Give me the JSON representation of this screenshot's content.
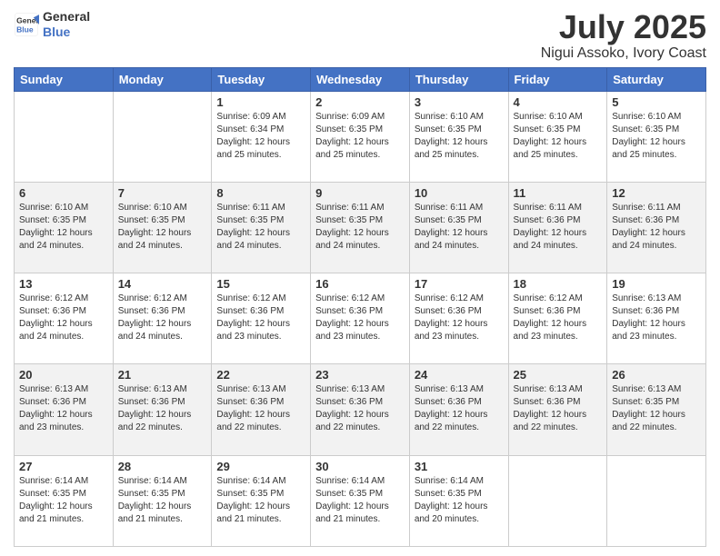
{
  "header": {
    "logo_line1": "General",
    "logo_line2": "Blue",
    "title": "July 2025",
    "subtitle": "Nigui Assoko, Ivory Coast"
  },
  "days_of_week": [
    "Sunday",
    "Monday",
    "Tuesday",
    "Wednesday",
    "Thursday",
    "Friday",
    "Saturday"
  ],
  "weeks": [
    [
      {
        "day": "",
        "info": ""
      },
      {
        "day": "",
        "info": ""
      },
      {
        "day": "1",
        "info": "Sunrise: 6:09 AM\nSunset: 6:34 PM\nDaylight: 12 hours\nand 25 minutes."
      },
      {
        "day": "2",
        "info": "Sunrise: 6:09 AM\nSunset: 6:35 PM\nDaylight: 12 hours\nand 25 minutes."
      },
      {
        "day": "3",
        "info": "Sunrise: 6:10 AM\nSunset: 6:35 PM\nDaylight: 12 hours\nand 25 minutes."
      },
      {
        "day": "4",
        "info": "Sunrise: 6:10 AM\nSunset: 6:35 PM\nDaylight: 12 hours\nand 25 minutes."
      },
      {
        "day": "5",
        "info": "Sunrise: 6:10 AM\nSunset: 6:35 PM\nDaylight: 12 hours\nand 25 minutes."
      }
    ],
    [
      {
        "day": "6",
        "info": "Sunrise: 6:10 AM\nSunset: 6:35 PM\nDaylight: 12 hours\nand 24 minutes."
      },
      {
        "day": "7",
        "info": "Sunrise: 6:10 AM\nSunset: 6:35 PM\nDaylight: 12 hours\nand 24 minutes."
      },
      {
        "day": "8",
        "info": "Sunrise: 6:11 AM\nSunset: 6:35 PM\nDaylight: 12 hours\nand 24 minutes."
      },
      {
        "day": "9",
        "info": "Sunrise: 6:11 AM\nSunset: 6:35 PM\nDaylight: 12 hours\nand 24 minutes."
      },
      {
        "day": "10",
        "info": "Sunrise: 6:11 AM\nSunset: 6:35 PM\nDaylight: 12 hours\nand 24 minutes."
      },
      {
        "day": "11",
        "info": "Sunrise: 6:11 AM\nSunset: 6:36 PM\nDaylight: 12 hours\nand 24 minutes."
      },
      {
        "day": "12",
        "info": "Sunrise: 6:11 AM\nSunset: 6:36 PM\nDaylight: 12 hours\nand 24 minutes."
      }
    ],
    [
      {
        "day": "13",
        "info": "Sunrise: 6:12 AM\nSunset: 6:36 PM\nDaylight: 12 hours\nand 24 minutes."
      },
      {
        "day": "14",
        "info": "Sunrise: 6:12 AM\nSunset: 6:36 PM\nDaylight: 12 hours\nand 24 minutes."
      },
      {
        "day": "15",
        "info": "Sunrise: 6:12 AM\nSunset: 6:36 PM\nDaylight: 12 hours\nand 23 minutes."
      },
      {
        "day": "16",
        "info": "Sunrise: 6:12 AM\nSunset: 6:36 PM\nDaylight: 12 hours\nand 23 minutes."
      },
      {
        "day": "17",
        "info": "Sunrise: 6:12 AM\nSunset: 6:36 PM\nDaylight: 12 hours\nand 23 minutes."
      },
      {
        "day": "18",
        "info": "Sunrise: 6:12 AM\nSunset: 6:36 PM\nDaylight: 12 hours\nand 23 minutes."
      },
      {
        "day": "19",
        "info": "Sunrise: 6:13 AM\nSunset: 6:36 PM\nDaylight: 12 hours\nand 23 minutes."
      }
    ],
    [
      {
        "day": "20",
        "info": "Sunrise: 6:13 AM\nSunset: 6:36 PM\nDaylight: 12 hours\nand 23 minutes."
      },
      {
        "day": "21",
        "info": "Sunrise: 6:13 AM\nSunset: 6:36 PM\nDaylight: 12 hours\nand 22 minutes."
      },
      {
        "day": "22",
        "info": "Sunrise: 6:13 AM\nSunset: 6:36 PM\nDaylight: 12 hours\nand 22 minutes."
      },
      {
        "day": "23",
        "info": "Sunrise: 6:13 AM\nSunset: 6:36 PM\nDaylight: 12 hours\nand 22 minutes."
      },
      {
        "day": "24",
        "info": "Sunrise: 6:13 AM\nSunset: 6:36 PM\nDaylight: 12 hours\nand 22 minutes."
      },
      {
        "day": "25",
        "info": "Sunrise: 6:13 AM\nSunset: 6:36 PM\nDaylight: 12 hours\nand 22 minutes."
      },
      {
        "day": "26",
        "info": "Sunrise: 6:13 AM\nSunset: 6:35 PM\nDaylight: 12 hours\nand 22 minutes."
      }
    ],
    [
      {
        "day": "27",
        "info": "Sunrise: 6:14 AM\nSunset: 6:35 PM\nDaylight: 12 hours\nand 21 minutes."
      },
      {
        "day": "28",
        "info": "Sunrise: 6:14 AM\nSunset: 6:35 PM\nDaylight: 12 hours\nand 21 minutes."
      },
      {
        "day": "29",
        "info": "Sunrise: 6:14 AM\nSunset: 6:35 PM\nDaylight: 12 hours\nand 21 minutes."
      },
      {
        "day": "30",
        "info": "Sunrise: 6:14 AM\nSunset: 6:35 PM\nDaylight: 12 hours\nand 21 minutes."
      },
      {
        "day": "31",
        "info": "Sunrise: 6:14 AM\nSunset: 6:35 PM\nDaylight: 12 hours\nand 20 minutes."
      },
      {
        "day": "",
        "info": ""
      },
      {
        "day": "",
        "info": ""
      }
    ]
  ]
}
